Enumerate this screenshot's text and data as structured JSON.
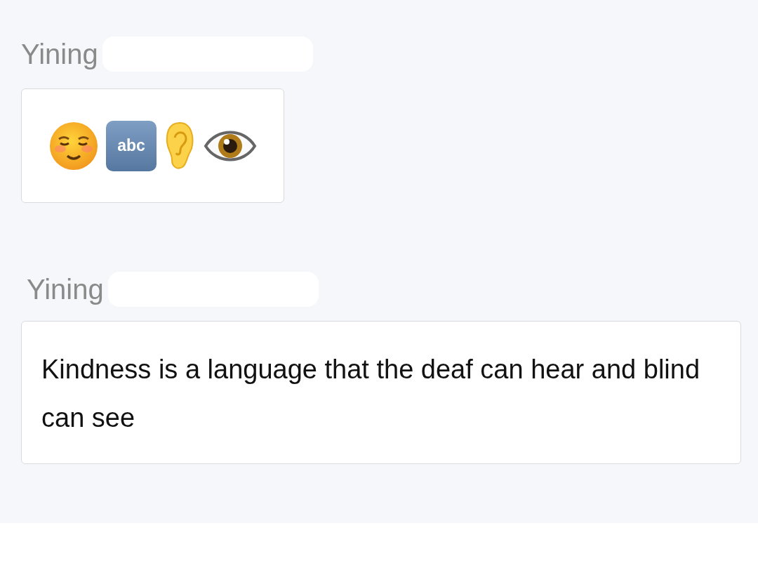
{
  "messages": [
    {
      "sender": "Yining",
      "kind": "emoji",
      "items": [
        {
          "kind": "smile"
        },
        {
          "kind": "abc",
          "label": "abc"
        },
        {
          "kind": "ear"
        },
        {
          "kind": "eye"
        }
      ]
    },
    {
      "sender": "Yining",
      "kind": "text",
      "text": "Kindness is a language that the deaf can hear and blind can see"
    }
  ]
}
